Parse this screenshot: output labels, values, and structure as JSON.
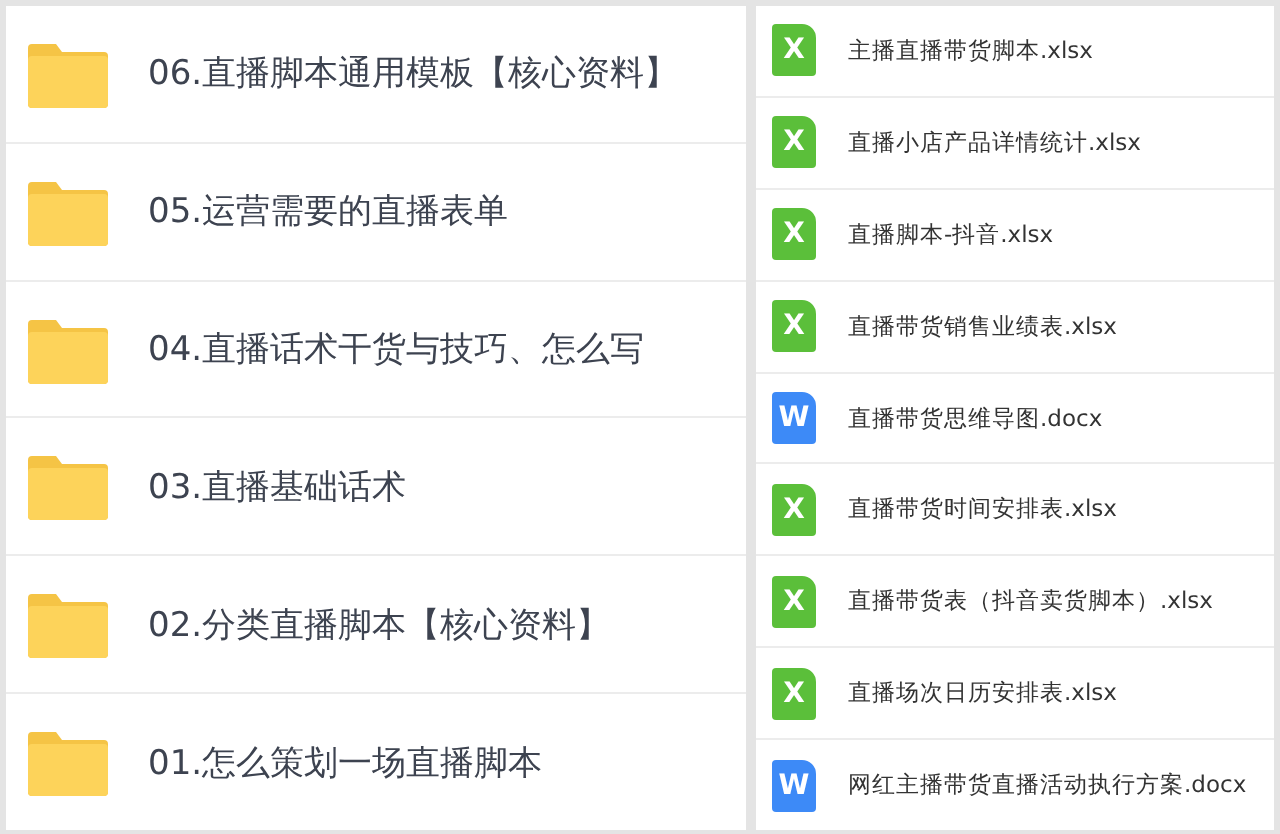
{
  "folders": [
    {
      "name": "06.直播脚本通用模板【核心资料】"
    },
    {
      "name": "05.运营需要的直播表单"
    },
    {
      "name": "04.直播话术干货与技巧、怎么写"
    },
    {
      "name": "03.直播基础话术"
    },
    {
      "name": "02.分类直播脚本【核心资料】"
    },
    {
      "name": "01.怎么策划一场直播脚本"
    }
  ],
  "files": [
    {
      "kind": "xlsx",
      "letter": "X",
      "name": "主播直播带货脚本.xlsx"
    },
    {
      "kind": "xlsx",
      "letter": "X",
      "name": "直播小店产品详情统计.xlsx"
    },
    {
      "kind": "xlsx",
      "letter": "X",
      "name": "直播脚本-抖音.xlsx"
    },
    {
      "kind": "xlsx",
      "letter": "X",
      "name": "直播带货销售业绩表.xlsx"
    },
    {
      "kind": "docx",
      "letter": "W",
      "name": "直播带货思维导图.docx"
    },
    {
      "kind": "xlsx",
      "letter": "X",
      "name": "直播带货时间安排表.xlsx"
    },
    {
      "kind": "xlsx",
      "letter": "X",
      "name": "直播带货表（抖音卖货脚本）.xlsx"
    },
    {
      "kind": "xlsx",
      "letter": "X",
      "name": "直播场次日历安排表.xlsx"
    },
    {
      "kind": "docx",
      "letter": "W",
      "name": "网红主播带货直播活动执行方案.docx"
    }
  ]
}
